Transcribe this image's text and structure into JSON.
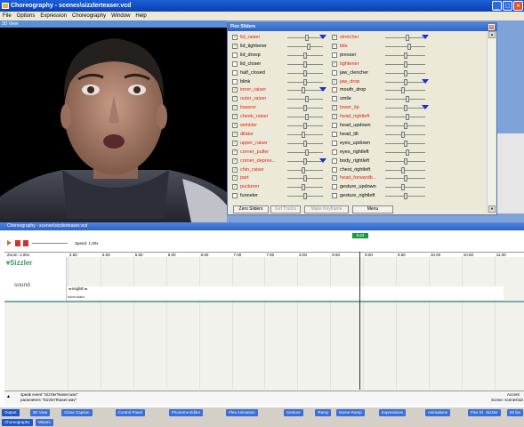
{
  "window": {
    "title": "Choreography - scenes\\sizzlerteaser.vcd"
  },
  "menu": [
    "File",
    "Options",
    "Expression",
    "Choreography",
    "Window",
    "Help"
  ],
  "view3d": {
    "title": "3D View"
  },
  "flex": {
    "title": "Flex Sliders",
    "left": [
      {
        "l": "lid_raiser",
        "c": true,
        "r": true,
        "t": true
      },
      {
        "l": "lid_tightener",
        "c": true,
        "r": false
      },
      {
        "l": "lid_droop",
        "c": false,
        "r": false
      },
      {
        "l": "lid_closer",
        "c": false,
        "r": false
      },
      {
        "l": "half_closed",
        "c": false,
        "r": false
      },
      {
        "l": "blink",
        "c": false,
        "r": false
      },
      {
        "l": "inner_raiser",
        "c": true,
        "r": true,
        "t": true
      },
      {
        "l": "outer_raiser",
        "c": true,
        "r": true
      },
      {
        "l": "lowerer",
        "c": true,
        "r": true
      },
      {
        "l": "cheek_raiser",
        "c": true,
        "r": true
      },
      {
        "l": "wrinkler",
        "c": true,
        "r": true
      },
      {
        "l": "dilator",
        "c": true,
        "r": true
      },
      {
        "l": "upper_raiser",
        "c": true,
        "r": true
      },
      {
        "l": "corner_puller",
        "c": true,
        "r": true
      },
      {
        "l": "corner_depres...",
        "c": true,
        "r": true,
        "t": true
      },
      {
        "l": "chin_raiser",
        "c": true,
        "r": true
      },
      {
        "l": "part",
        "c": true,
        "r": true
      },
      {
        "l": "puckerer",
        "c": true,
        "r": true
      },
      {
        "l": "funneler",
        "c": false,
        "r": false
      }
    ],
    "right": [
      {
        "l": "stretcher",
        "c": true,
        "r": true,
        "t": true
      },
      {
        "l": "bite",
        "c": true,
        "r": true
      },
      {
        "l": "presser",
        "c": false,
        "r": false
      },
      {
        "l": "tightener",
        "c": true,
        "r": true
      },
      {
        "l": "jaw_clencher",
        "c": false,
        "r": false
      },
      {
        "l": "jaw_drop",
        "c": true,
        "r": true,
        "t": true
      },
      {
        "l": "mouth_drop",
        "c": false,
        "r": false
      },
      {
        "l": "smile",
        "c": false,
        "r": false
      },
      {
        "l": "lower_lip",
        "c": true,
        "r": true,
        "t": true
      },
      {
        "l": "head_rightleft",
        "c": true,
        "r": true
      },
      {
        "l": "head_updown",
        "c": false,
        "r": false
      },
      {
        "l": "head_tilt",
        "c": false,
        "r": false
      },
      {
        "l": "eyes_updown",
        "c": false,
        "r": false
      },
      {
        "l": "eyes_rightleft",
        "c": false,
        "r": false
      },
      {
        "l": "body_rightleft",
        "c": false,
        "r": false
      },
      {
        "l": "chest_rightleft",
        "c": false,
        "r": false
      },
      {
        "l": "head_forwardb...",
        "c": true,
        "r": true
      },
      {
        "l": "gesture_updown",
        "c": false,
        "r": false
      },
      {
        "l": "gesture_rightleft",
        "c": false,
        "r": false
      }
    ],
    "buttons": [
      "Zero Sliders",
      "Get Tracks",
      "Make Keyframe",
      "Menu"
    ]
  },
  "choreo": {
    "title": "Choreography - scenes\\sizzlerteaser.vcd",
    "speed": "Speed: 1.00x",
    "zoom": "Zoom: 1.00x",
    "marker": "8.63",
    "ticks": [
      "4.50",
      "5.00",
      "5.50",
      "6.00",
      "6.50",
      "7.00",
      "7.50",
      "8.00",
      "8.50",
      "9.00",
      "9.50",
      "10.00",
      "10.50",
      "11.00"
    ],
    "actor": "Sizzler",
    "channel": "sound",
    "ev1": "english",
    "ev2": "token/data",
    "status1": "speak event \"SizzlerTeaser.wav\"",
    "status2": "parameters \"SizzlerTeaser.wav\"",
    "accent": "Accent",
    "scene": "Scene: scenes\\siz"
  },
  "tabs1": [
    "Output",
    "3D View",
    "Close Caption",
    "Control Panel",
    "Phoneme Editor",
    "Flex Animation",
    "Gesture",
    "Ramp",
    "Scene Ramp",
    "Expressions",
    "Animations",
    "Flex Sliders"
  ],
  "tabs1r": [
    "Sizzler",
    "60 fps"
  ],
  "tabs2": [
    "Choreography",
    "Waves"
  ]
}
